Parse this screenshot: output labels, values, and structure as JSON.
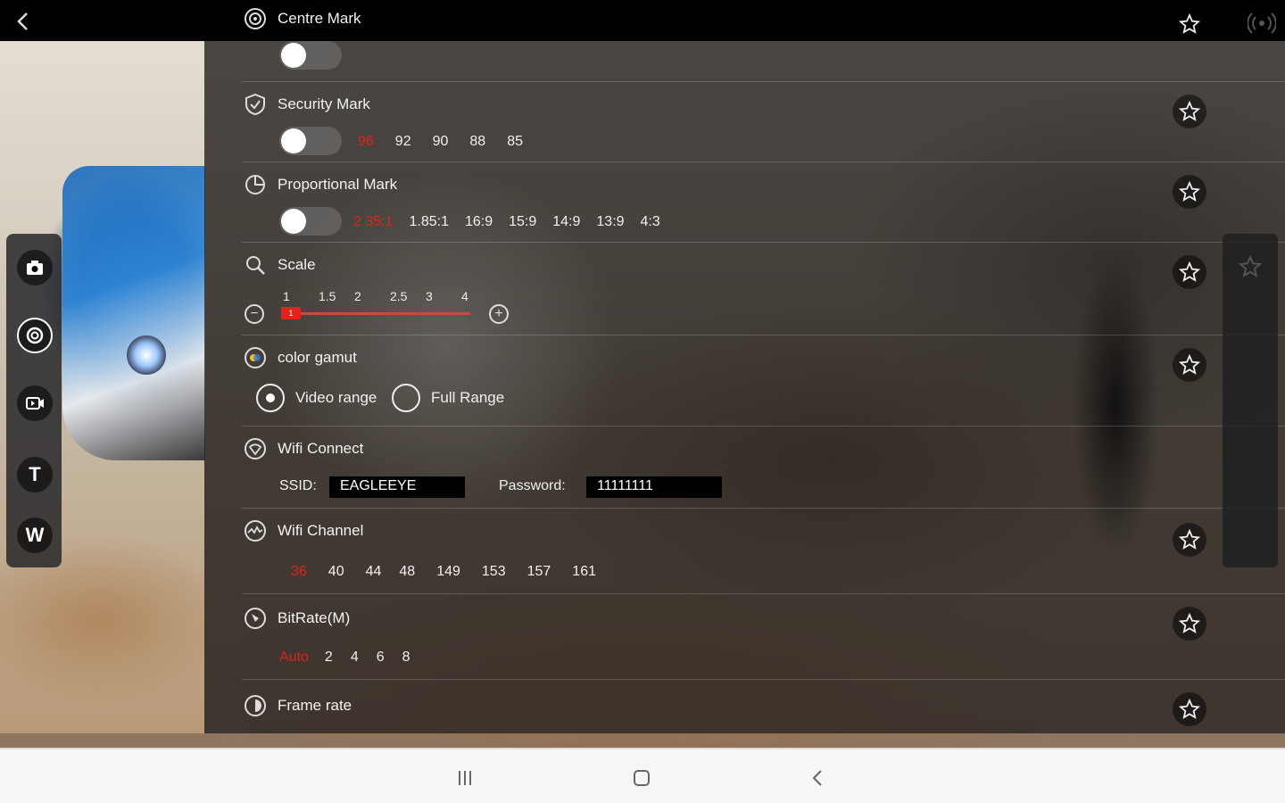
{
  "header": {
    "title": "Centre Mark"
  },
  "rows": {
    "centre_mark": {
      "title": "Centre Mark",
      "enabled": false
    },
    "security_mark": {
      "title": "Security Mark",
      "enabled": false,
      "options": [
        "96",
        "92",
        "90",
        "88",
        "85"
      ],
      "selected": "96"
    },
    "proportional_mark": {
      "title": "Proportional Mark",
      "enabled": false,
      "options": [
        "2.35:1",
        "1.85:1",
        "16:9",
        "15:9",
        "14:9",
        "13:9",
        "4:3"
      ],
      "selected": "2.35:1"
    },
    "scale": {
      "title": "Scale",
      "ticks": [
        "1",
        "1.5",
        "2",
        "2.5",
        "3",
        "4"
      ],
      "value": "1",
      "minus": "−",
      "plus": "+"
    },
    "color_gamut": {
      "title": "color gamut",
      "options": [
        "Video range",
        "Full Range"
      ],
      "selected": "Video range"
    },
    "wifi_connect": {
      "title": "Wifi Connect",
      "ssid_label": "SSID:",
      "ssid_value": "EAGLEEYE",
      "password_label": "Password:",
      "password_value": "11111111"
    },
    "wifi_channel": {
      "title": "Wifi Channel",
      "options": [
        "36",
        "40",
        "44",
        "48",
        "149",
        "153",
        "157",
        "161"
      ],
      "selected": "36"
    },
    "bitrate": {
      "title": "BitRate(M)",
      "options": [
        "Auto",
        "2",
        "4",
        "6",
        "8"
      ],
      "selected": "Auto"
    },
    "frame_rate": {
      "title": "Frame rate"
    }
  },
  "rail": {
    "t_label": "T",
    "w_label": "W"
  },
  "colors": {
    "accent": "#e0231c",
    "panel_overlay": "#1e1c1a"
  },
  "icons": [
    "back-arrow-icon",
    "target-icon",
    "shield-icon",
    "pie-icon",
    "magnifier-icon",
    "color-gamut-icon",
    "wifi-icon",
    "wave-icon",
    "bitrate-icon",
    "contrast-icon",
    "star-icon",
    "camera-icon",
    "settings-icon",
    "video-icon",
    "signal-icon"
  ]
}
